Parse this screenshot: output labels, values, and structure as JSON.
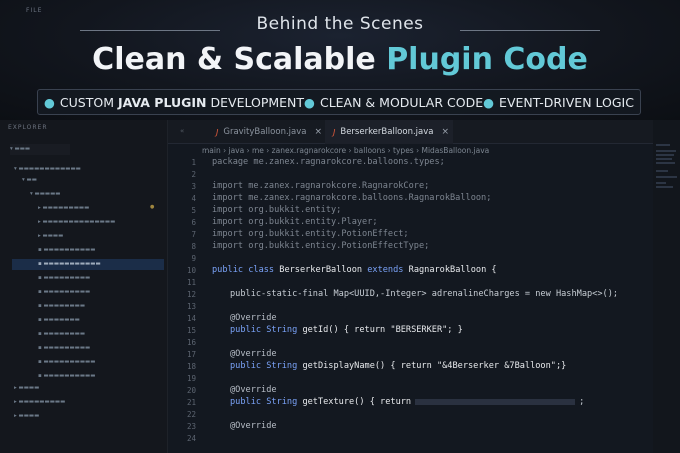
{
  "menu": {
    "file": "FILE"
  },
  "hero": {
    "subtitle": "Behind the Scenes",
    "title_main": "Clean & Scalable ",
    "title_accent": "Plugin Code",
    "features": [
      {
        "pre": "CUSTOM ",
        "bold": "JAVA PLUGIN",
        "post": " DEVELOPMENT"
      },
      {
        "pre": "CLEAN & MODULAR CODE",
        "bold": "",
        "post": ""
      },
      {
        "pre": "EVENT-DRIVEN LOGIC",
        "bold": "",
        "post": ""
      }
    ]
  },
  "explorer": {
    "title": "EXPLORER"
  },
  "tabs": [
    {
      "label": "GravityBalloon.java",
      "active": false
    },
    {
      "label": "BerserkerBalloon.java",
      "active": true
    }
  ],
  "breadcrumb": "main › java › me › zanex.ragnarokcore › balloons › types › MidasBalloon.java",
  "colors": {
    "accent": "#62c9d7",
    "keyword": "#7aa2f7",
    "java_icon": "#e25b3b"
  },
  "code_lines": [
    {
      "n": "16",
      "html": "package"
    },
    {
      "n": "17",
      "html": ""
    },
    {
      "n": "18",
      "html": "import"
    },
    {
      "n": "19",
      "html": "import"
    },
    {
      "n": "20",
      "html": "import"
    },
    {
      "n": "21",
      "html": "import"
    },
    {
      "n": "22",
      "html": "import"
    },
    {
      "n": "23",
      "html": "import"
    }
  ],
  "code": {
    "l1": "package me.zanex.ragnarokcore.balloons.types;",
    "l3": "import me.zanex.ragnarokcore.RagnarokCore;",
    "l4": "import me.zanex.ragnarokcore.balloons.RagnarokBalloon;",
    "l5": "import org.bukkit.entity;",
    "l6": "import org.bukkit.entity.Player;",
    "l7": "import org.bukkit.entity.PotionEffect;",
    "l8": "import org.bukkit.enticy.PotionEffectType;",
    "l10_a": "public class ",
    "l10_b": "BerserkerBalloon ",
    "l10_c": "extends ",
    "l10_d": "RagnarokBalloon {",
    "l12": "public-static-final Map<UUID,-Integer> adrenalineCharges = new HashMap<>();",
    "l14": "@Override",
    "l15_a": "public String ",
    "l15_b": "getId() { return \"BERSERKER\"; }",
    "l17": "@Override",
    "l18_a": "public String ",
    "l18_b": "getDisplayName() { return \"&4Berserker &7Balloon\";}",
    "l20": "@Override",
    "l21_a": "public String ",
    "l21_b": "getTexture() { return",
    "l23": "@Override"
  },
  "line_numbers": [
    "1",
    "2",
    "3",
    "4",
    "5",
    "6",
    "7",
    "8",
    "9",
    "10",
    "11",
    "12",
    "13",
    "14",
    "15",
    "16",
    "17",
    "18",
    "19",
    "20",
    "21",
    "22",
    "23",
    "24"
  ]
}
